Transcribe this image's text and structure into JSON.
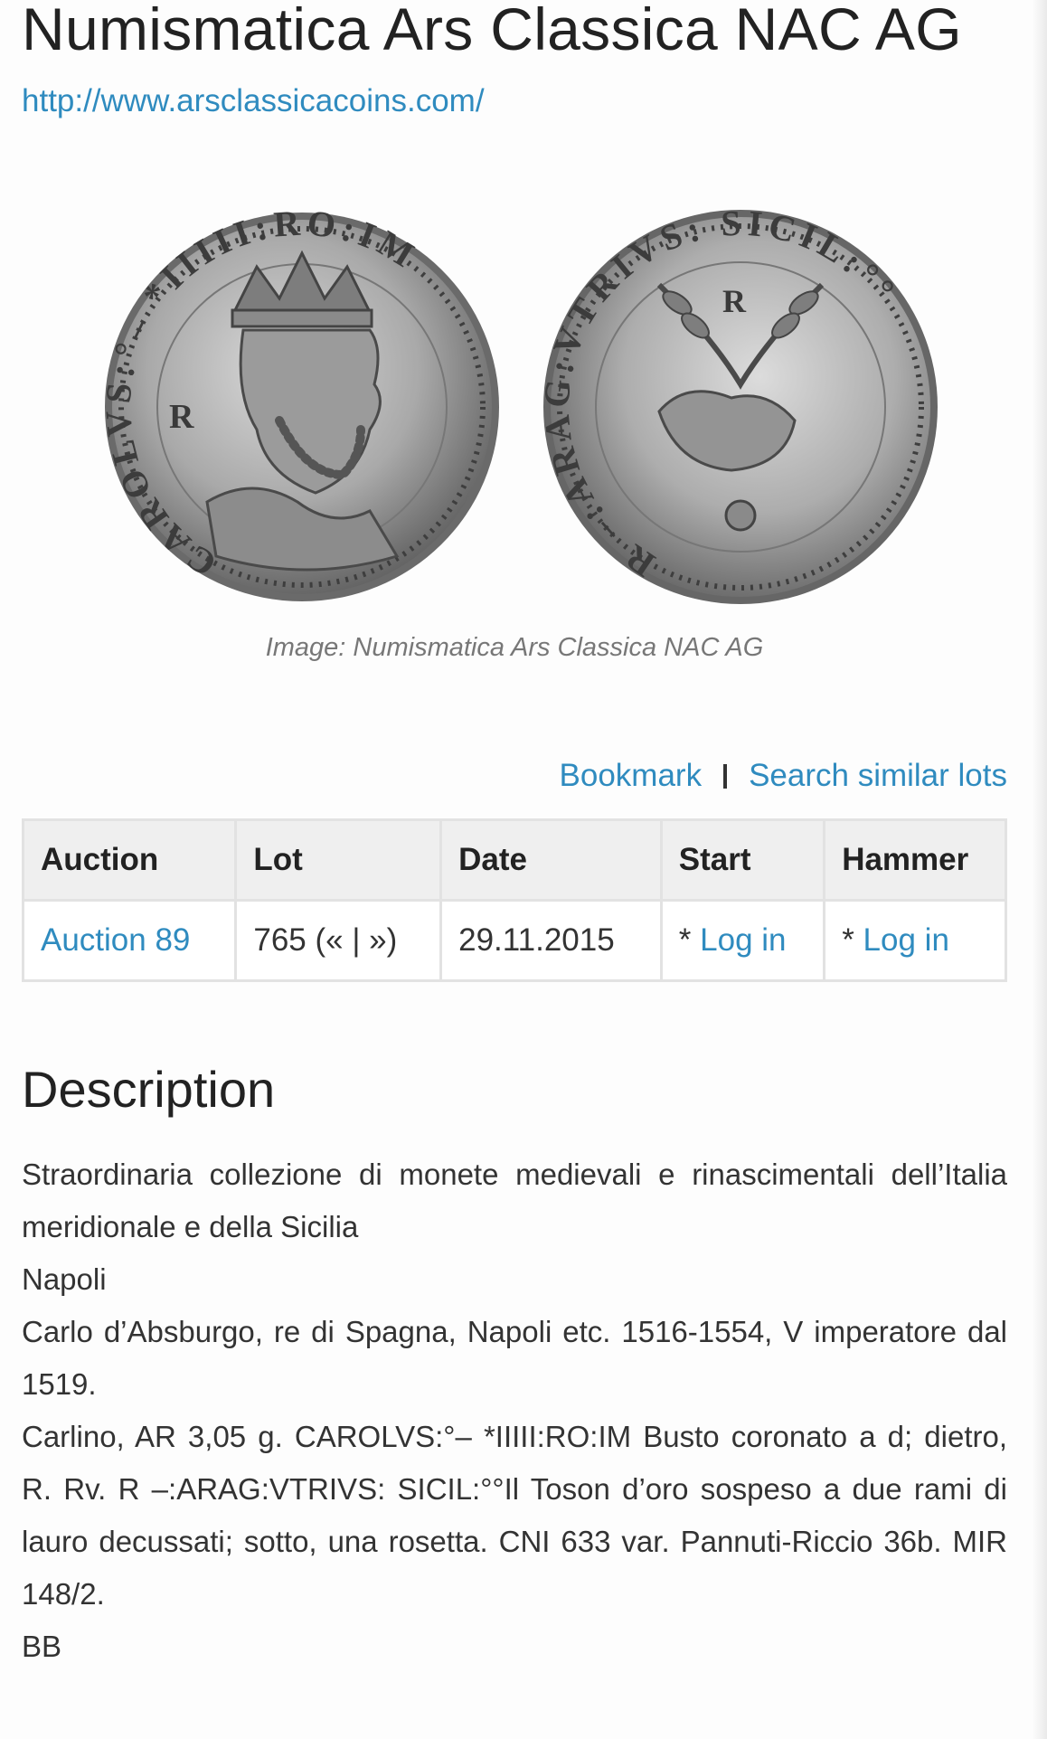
{
  "header": {
    "title": "Numismatica Ars Classica NAC AG",
    "website": "http://www.arsclassicacoins.com/"
  },
  "image": {
    "caption": "Image: Numismatica Ars Classica NAC AG",
    "obverse_legend": "CAROLVS:°– *IIIII:RO:IM",
    "reverse_legend": "R –:ARAG:VTRIVS: SICIL:°°"
  },
  "actions": {
    "bookmark": "Bookmark",
    "search_similar": "Search similar lots"
  },
  "table": {
    "headers": [
      "Auction",
      "Lot",
      "Date",
      "Start",
      "Hammer"
    ],
    "row": {
      "auction": "Auction 89",
      "lot": "765 (« | »)",
      "date": "29.11.2015",
      "start_prefix": "* ",
      "start_link": "Log in",
      "hammer_prefix": "* ",
      "hammer_link": "Log in"
    }
  },
  "description": {
    "heading": "Description",
    "paragraphs": [
      "Straordinaria collezione di monete medievali e rinascimentali dell’Italia meridionale e della Sicilia",
      "Napoli",
      "Carlo d’Absburgo, re di Spagna, Napoli etc. 1516-1554, V imperatore dal 1519.",
      "Carlino, AR 3,05 g. CAROLVS:°– *IIIII:RO:IM Busto coronato a d; dietro, R. Rv. R –:ARAG:VTRIVS: SICIL:°°Il Toson d’oro sospeso a due rami di lauro decussati; sotto, una rosetta. CNI 633 var. Pannuti-Riccio 36b. MIR 148/2.",
      "BB"
    ]
  }
}
